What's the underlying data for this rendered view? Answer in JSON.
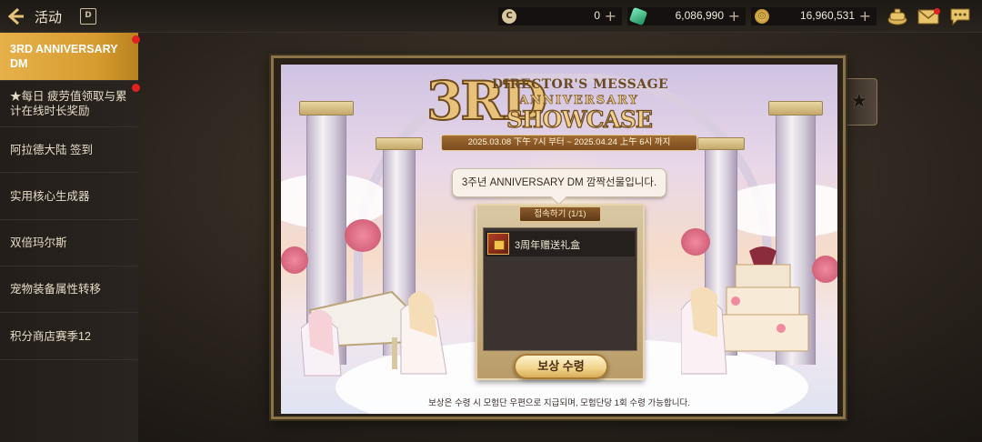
{
  "header": {
    "title": "活动",
    "calendar_icon_label": "D",
    "currencies": [
      {
        "icon": "coin-c-icon",
        "value": "0"
      },
      {
        "icon": "green-gem-icon",
        "value": "6,086,990"
      },
      {
        "icon": "gold-coin-icon",
        "value": "16,960,531"
      }
    ],
    "plus_label": "+"
  },
  "sidebar": {
    "items": [
      {
        "label": "3RD ANNIVERSARY DM",
        "active": true,
        "badge": true
      },
      {
        "label": "★每日 疲劳值领取与累计在线时长奖励",
        "active": false,
        "badge": true
      },
      {
        "label": "阿拉德大陆 签到",
        "active": false,
        "badge": false
      },
      {
        "label": "实用核心生成器",
        "active": false,
        "badge": false
      },
      {
        "label": "双倍玛尔斯",
        "active": false,
        "badge": false
      },
      {
        "label": "宠物装备属性转移",
        "active": false,
        "badge": false
      },
      {
        "label": "积分商店赛季12",
        "active": false,
        "badge": false
      }
    ]
  },
  "banner": {
    "directors_message": "DIRECTOR'S MESSAGE",
    "big_number": "3RD",
    "anniversary": "ANNIVERSARY",
    "showcase": "SHOWCASE",
    "date_range": "2025.03.08 下午 7시 부터 ~ 2025.04.24 上午 6시 까지"
  },
  "dialog": {
    "speech": "3주년 ANNIVERSARY DM 깜짝선물입니다.",
    "panel_title": "접속하기 (1/1)",
    "reward_item": "3周年赠送礼盒",
    "claim_button": "보상 수령",
    "footnote": "보상은 수령 시 모험단 우편으로 지급되며, 모험단당 1회 수령 가능합니다."
  },
  "colors": {
    "active_tab": "#e0a640",
    "badge": "#e02222",
    "claim_button": "#f0d289"
  }
}
